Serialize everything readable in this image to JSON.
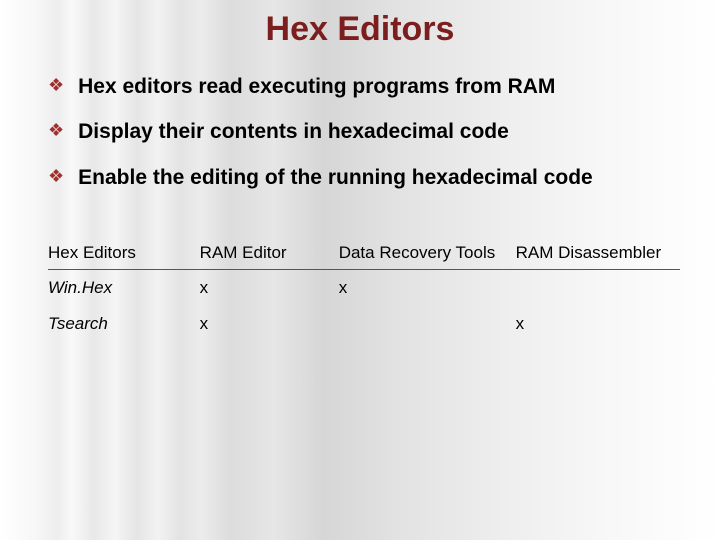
{
  "title": "Hex Editors",
  "bullets": [
    "Hex editors read executing programs from RAM",
    "Display their contents in hexadecimal code",
    "Enable the editing of the running hexadecimal code"
  ],
  "table": {
    "headers": [
      "Hex Editors",
      "RAM Editor",
      "Data Recovery Tools",
      "RAM Disassembler"
    ],
    "rows": [
      {
        "name": "Win.Hex",
        "cells": [
          "x",
          "x",
          ""
        ]
      },
      {
        "name": "Tsearch",
        "cells": [
          "x",
          "",
          "x"
        ]
      }
    ]
  }
}
